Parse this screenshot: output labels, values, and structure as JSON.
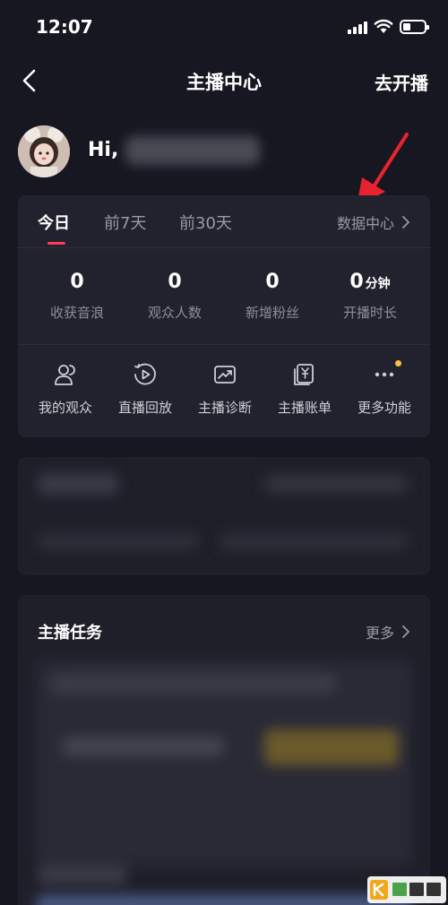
{
  "status_bar": {
    "time": "12:07"
  },
  "nav": {
    "title": "主播中心",
    "action": "去开播"
  },
  "profile": {
    "greeting": "Hi,"
  },
  "stats_card": {
    "tabs": [
      "今日",
      "前7天",
      "前30天"
    ],
    "active_tab": "今日",
    "data_center": "数据中心",
    "stats": [
      {
        "value": "0",
        "unit": "",
        "label": "收获音浪"
      },
      {
        "value": "0",
        "unit": "",
        "label": "观众人数"
      },
      {
        "value": "0",
        "unit": "",
        "label": "新增粉丝"
      },
      {
        "value": "0",
        "unit": "分钟",
        "label": "开播时长"
      }
    ],
    "tools": [
      {
        "label": "我的观众",
        "icon": "audience-icon"
      },
      {
        "label": "直播回放",
        "icon": "replay-icon"
      },
      {
        "label": "主播诊断",
        "icon": "diagnosis-icon"
      },
      {
        "label": "主播账单",
        "icon": "bill-icon"
      },
      {
        "label": "更多功能",
        "icon": "more-icon"
      }
    ]
  },
  "tasks_card": {
    "title": "主播任务",
    "more": "更多"
  },
  "colors": {
    "accent": "#ff3b5c",
    "annotation_arrow": "#e8232f",
    "badge_dot": "#f7c23a"
  }
}
